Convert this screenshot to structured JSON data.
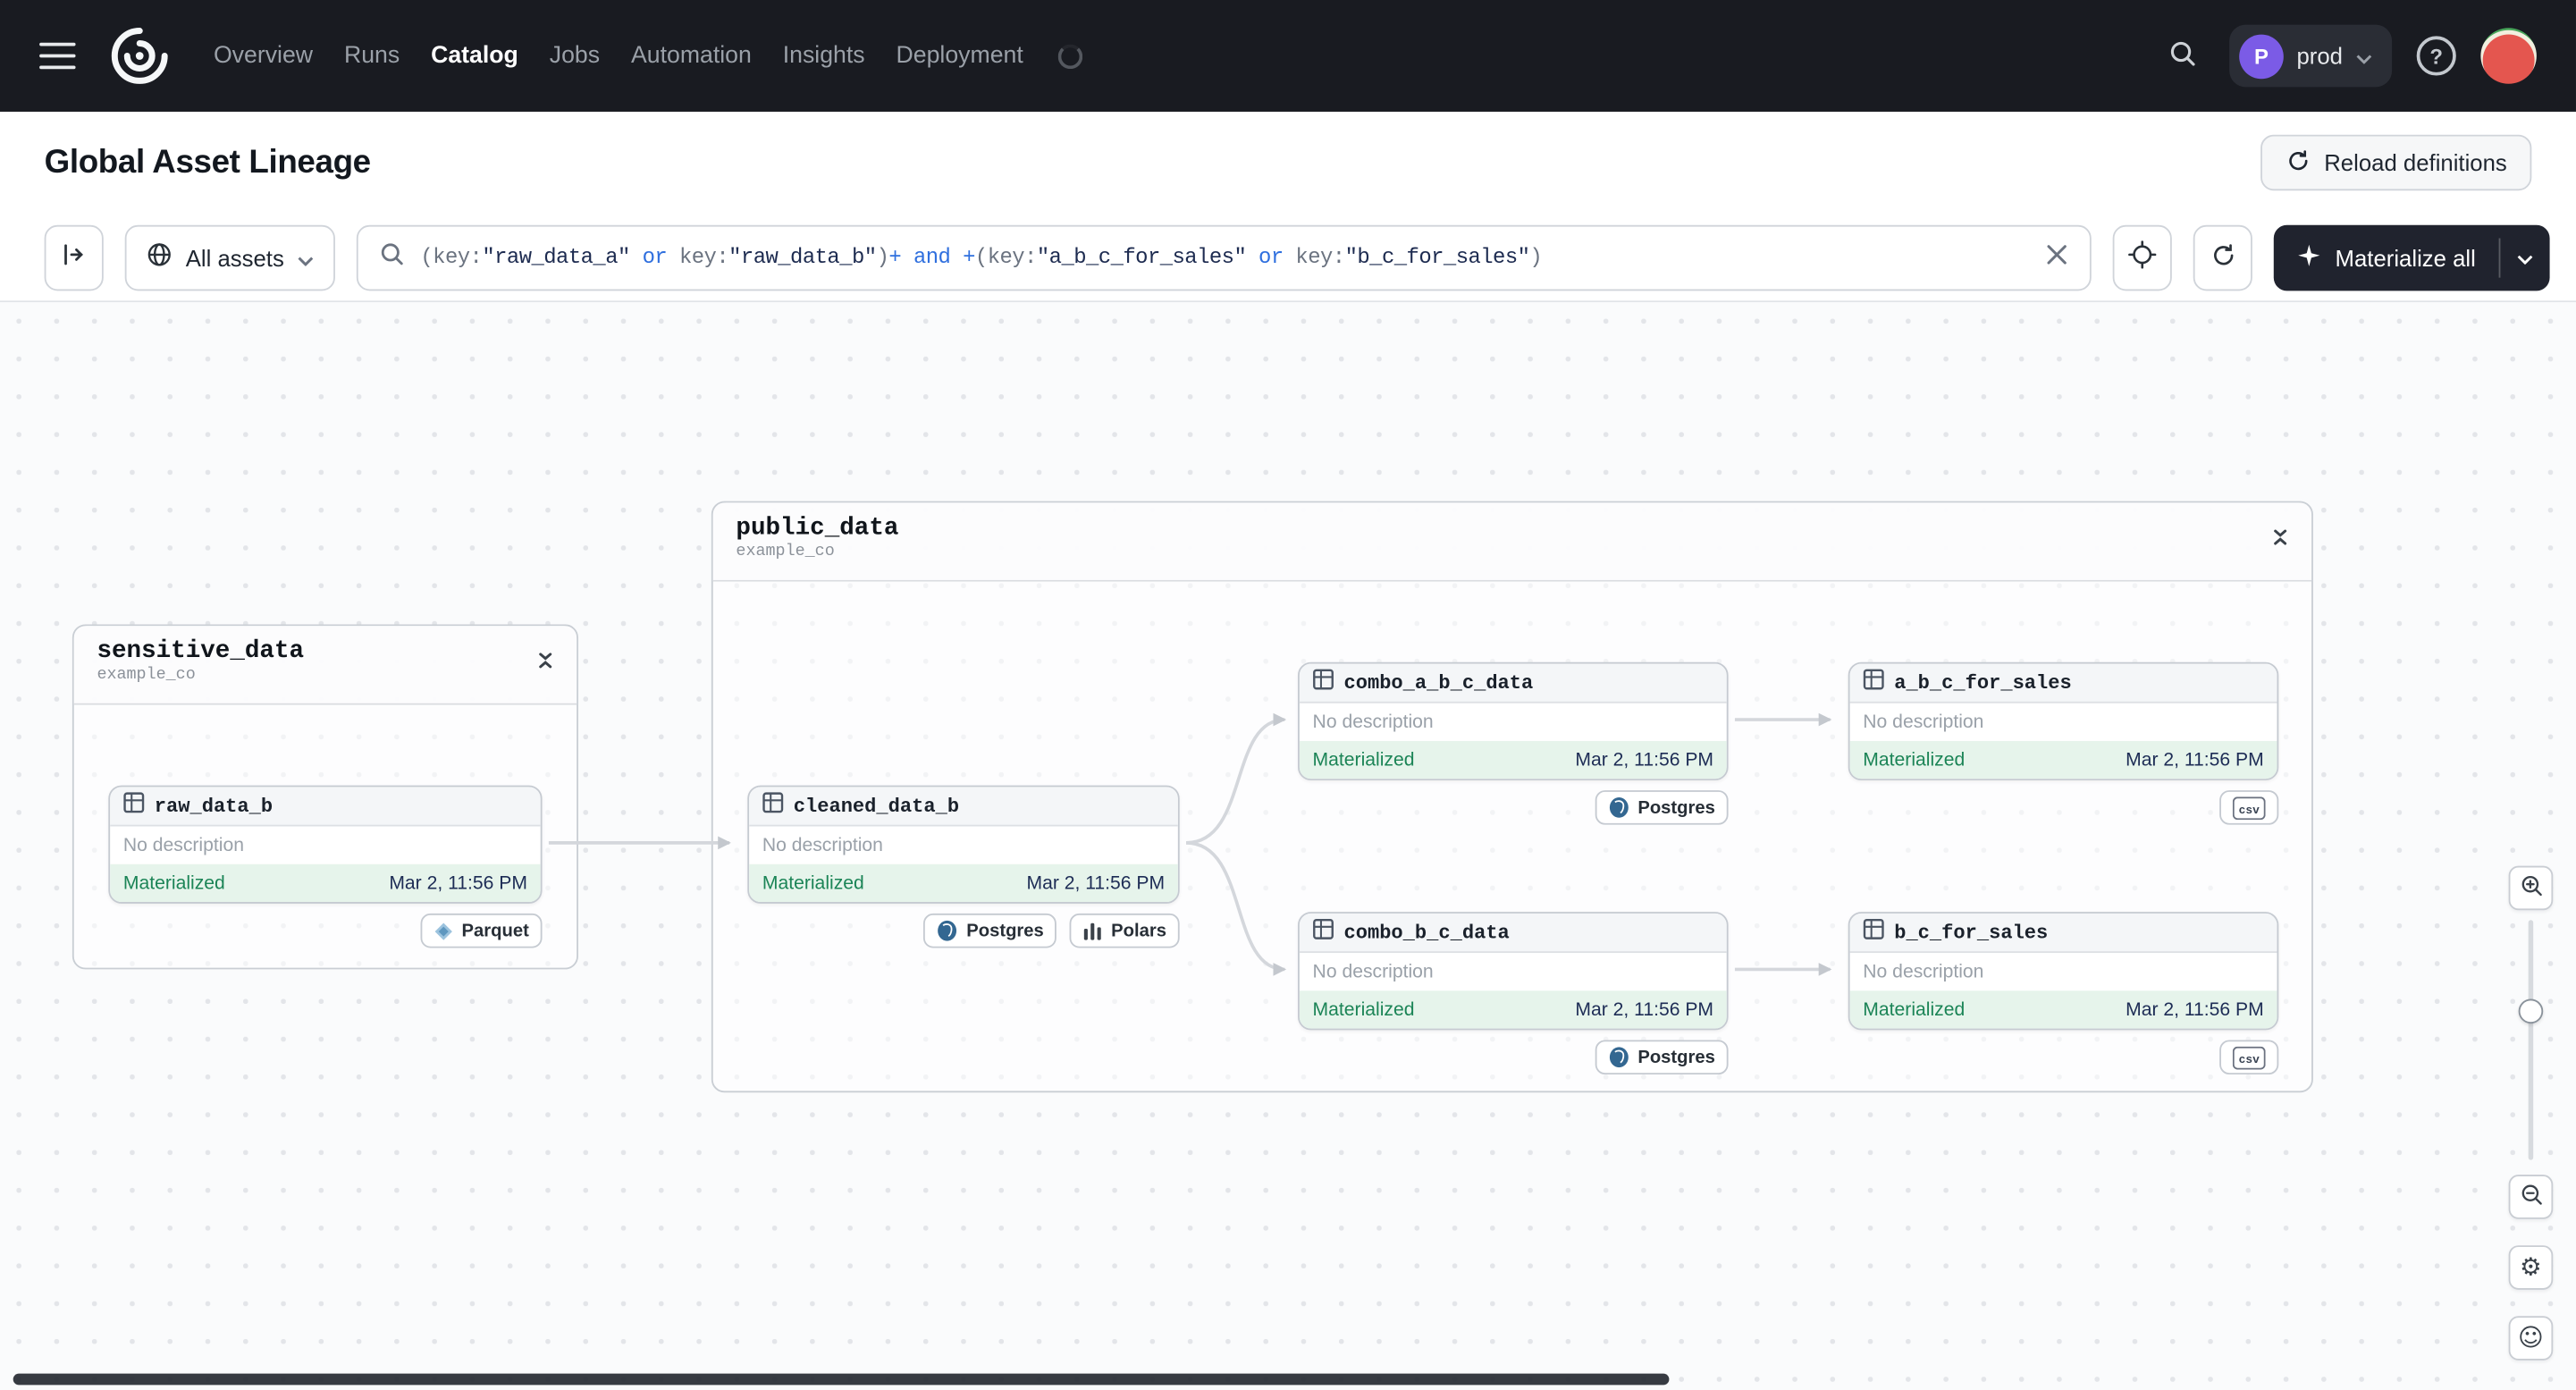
{
  "nav": {
    "items": [
      "Overview",
      "Runs",
      "Catalog",
      "Jobs",
      "Automation",
      "Insights",
      "Deployment"
    ],
    "active_item": "Catalog",
    "env_badge": {
      "initial": "P",
      "name": "prod"
    }
  },
  "page": {
    "title": "Global Asset Lineage",
    "reload_button_label": "Reload definitions"
  },
  "toolbar": {
    "scope_label": "All assets",
    "materialize_label": "Materialize all",
    "query": "(key:\"raw_data_a\" or key:\"raw_data_b\")+ and +(key:\"a_b_c_for_sales\" or key:\"b_c_for_sales\")",
    "query_segments": [
      {
        "text": "(key:",
        "type": "punct"
      },
      {
        "text": "\"raw_data_a\"",
        "type": "string"
      },
      {
        "text": " or ",
        "type": "operator"
      },
      {
        "text": "key:",
        "type": "punct"
      },
      {
        "text": "\"raw_data_b\"",
        "type": "string"
      },
      {
        "text": ")",
        "type": "punct"
      },
      {
        "text": "+ and +",
        "type": "operator"
      },
      {
        "text": "(key:",
        "type": "punct"
      },
      {
        "text": "\"a_b_c_for_sales\"",
        "type": "string"
      },
      {
        "text": " or ",
        "type": "operator"
      },
      {
        "text": "key:",
        "type": "punct"
      },
      {
        "text": "\"b_c_for_sales\"",
        "type": "string"
      },
      {
        "text": ")",
        "type": "punct"
      }
    ]
  },
  "graph": {
    "groups": [
      {
        "title": "sensitive_data",
        "subtitle": "example_co"
      },
      {
        "title": "public_data",
        "subtitle": "example_co"
      }
    ],
    "nodes": [
      {
        "name": "raw_data_b",
        "description": "No description",
        "status": "Materialized",
        "timestamp": "Mar 2, 11:56 PM",
        "tags": [
          {
            "label": "Parquet",
            "icon": "parquet-icon"
          }
        ]
      },
      {
        "name": "cleaned_data_b",
        "description": "No description",
        "status": "Materialized",
        "timestamp": "Mar 2, 11:56 PM",
        "tags": [
          {
            "label": "Postgres",
            "icon": "postgres-icon"
          },
          {
            "label": "Polars",
            "icon": "polars-icon"
          }
        ]
      },
      {
        "name": "combo_a_b_c_data",
        "description": "No description",
        "status": "Materialized",
        "timestamp": "Mar 2, 11:56 PM",
        "tags": [
          {
            "label": "Postgres",
            "icon": "postgres-icon"
          }
        ]
      },
      {
        "name": "a_b_c_for_sales",
        "description": "No description",
        "status": "Materialized",
        "timestamp": "Mar 2, 11:56 PM",
        "tags": [
          {
            "label": "csv",
            "icon": "csv-icon"
          }
        ]
      },
      {
        "name": "combo_b_c_data",
        "description": "No description",
        "status": "Materialized",
        "timestamp": "Mar 2, 11:56 PM",
        "tags": [
          {
            "label": "Postgres",
            "icon": "postgres-icon"
          }
        ]
      },
      {
        "name": "b_c_for_sales",
        "description": "No description",
        "status": "Materialized",
        "timestamp": "Mar 2, 11:56 PM",
        "tags": [
          {
            "label": "csv",
            "icon": "csv-icon"
          }
        ]
      }
    ]
  },
  "colors": {
    "nav_bg": "#191B21",
    "materialized_text": "#1B8456",
    "materialized_bg": "#E6F4EB",
    "timestamp_navy": "#1D2C55",
    "env_badge_purple": "#7B5BE6",
    "operator_blue": "#2F6FDE",
    "edge_gray": "#D4D7DC"
  }
}
